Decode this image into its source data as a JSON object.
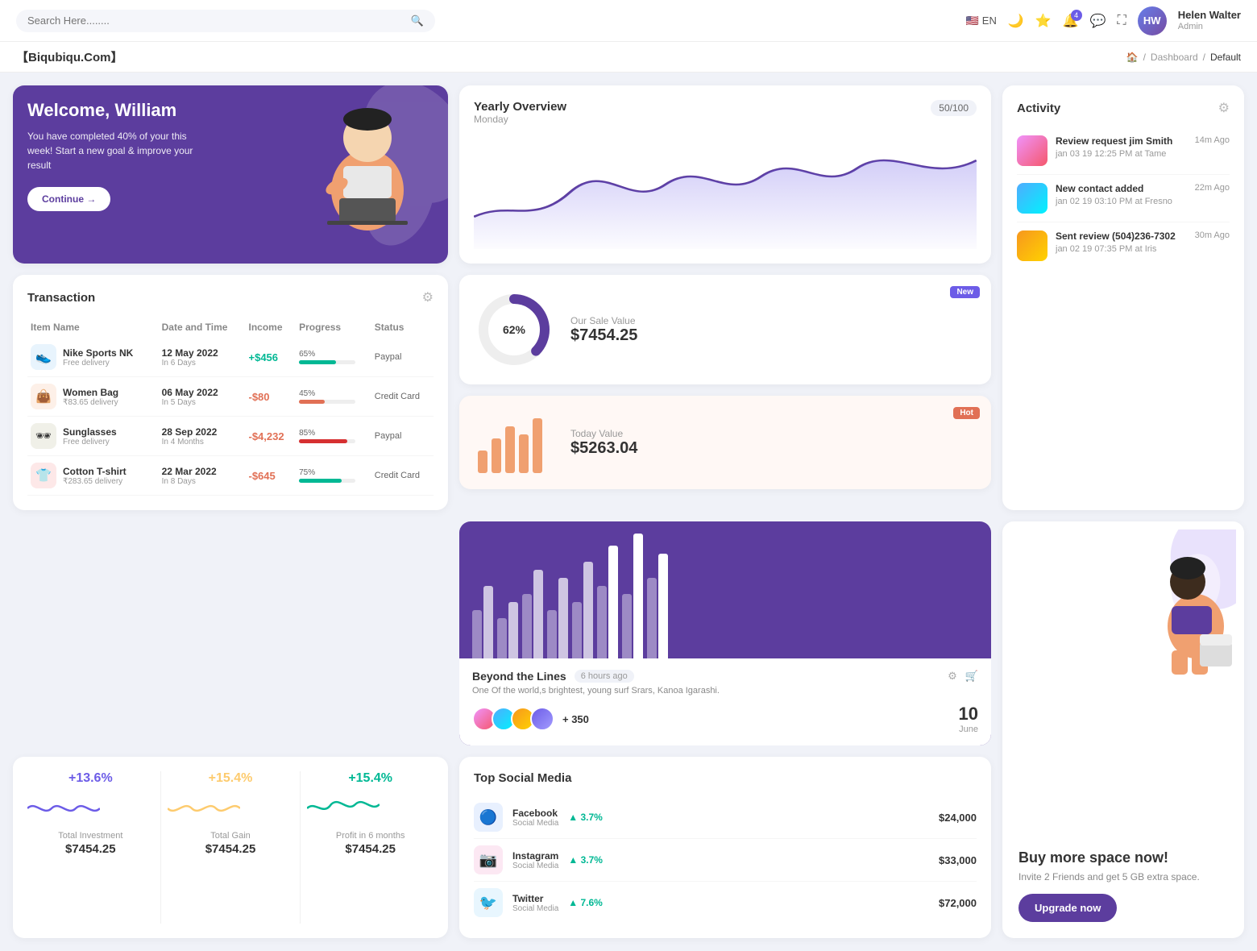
{
  "topbar": {
    "search_placeholder": "Search Here........",
    "lang": "EN",
    "notification_count": "4",
    "user_name": "Helen Walter",
    "user_role": "Admin"
  },
  "breadcrumb": {
    "brand": "【Biqubiqu.Com】",
    "home": "🏠",
    "dashboard": "Dashboard",
    "current": "Default"
  },
  "welcome": {
    "title": "Welcome, William",
    "subtitle": "You have completed 40% of your this week! Start a new goal & improve your result",
    "cta": "Continue →"
  },
  "yearly": {
    "title": "Yearly Overview",
    "subtitle": "Monday",
    "badge": "50/100"
  },
  "activity": {
    "title": "Activity",
    "items": [
      {
        "title": "Review request jim Smith",
        "subtitle": "jan 03 19 12:25 PM at Tame",
        "time": "14m Ago"
      },
      {
        "title": "New contact added",
        "subtitle": "jan 02 19 03:10 PM at Fresno",
        "time": "22m Ago"
      },
      {
        "title": "Sent review (504)236-7302",
        "subtitle": "jan 02 19 07:35 PM at Iris",
        "time": "30m Ago"
      }
    ]
  },
  "transaction": {
    "title": "Transaction",
    "columns": [
      "Item Name",
      "Date and Time",
      "Income",
      "Progress",
      "Status"
    ],
    "rows": [
      {
        "icon": "👟",
        "icon_bg": "#e8f4fd",
        "name": "Nike Sports NK",
        "sub": "Free delivery",
        "date": "12 May 2022",
        "days": "In 6 Days",
        "income": "+$456",
        "income_type": "pos",
        "progress": 65,
        "progress_color": "#00b894",
        "status": "Paypal"
      },
      {
        "icon": "👜",
        "icon_bg": "#fdf0e8",
        "name": "Women Bag",
        "sub": "₹83.65 delivery",
        "date": "06 May 2022",
        "days": "In 5 Days",
        "income": "-$80",
        "income_type": "neg",
        "progress": 45,
        "progress_color": "#e17055",
        "status": "Credit Card"
      },
      {
        "icon": "🕶",
        "icon_bg": "#f0f0e8",
        "name": "Sunglasses",
        "sub": "Free delivery",
        "date": "28 Sep 2022",
        "days": "In 4 Months",
        "income": "-$4,232",
        "income_type": "neg",
        "progress": 85,
        "progress_color": "#d63031",
        "status": "Paypal"
      },
      {
        "icon": "👕",
        "icon_bg": "#fde8e8",
        "name": "Cotton T-shirt",
        "sub": "₹283.65 delivery",
        "date": "22 Mar 2022",
        "days": "In 8 Days",
        "income": "-$645",
        "income_type": "neg",
        "progress": 75,
        "progress_color": "#00b894",
        "status": "Credit Card"
      }
    ]
  },
  "sale_value": {
    "badge": "New",
    "donut_pct": "62%",
    "label": "Our Sale Value",
    "value": "$7454.25"
  },
  "today_value": {
    "badge": "Hot",
    "label": "Today Value",
    "value": "$5263.04"
  },
  "beyond": {
    "title": "Beyond the Lines",
    "time_ago": "6 hours ago",
    "desc": "One Of the world,s brightest, young surf Srars, Kanoa Igarashi.",
    "extra_count": "+ 350",
    "date_day": "10",
    "date_month": "June"
  },
  "stats": [
    {
      "pct": "+13.6%",
      "label": "Total Investment",
      "value": "$7454.25",
      "color": "#6c5ce7"
    },
    {
      "pct": "+15.4%",
      "label": "Total Gain",
      "value": "$7454.25",
      "color": "#fdcb6e"
    },
    {
      "pct": "+15.4%",
      "label": "Profit in 6 months",
      "value": "$7454.25",
      "color": "#00b894"
    }
  ],
  "social": {
    "title": "Top Social Media",
    "items": [
      {
        "icon": "f",
        "icon_bg": "#e8f0fe",
        "icon_color": "#1877f2",
        "name": "Facebook",
        "type": "Social Media",
        "pct": "3.7%",
        "value": "$24,000"
      },
      {
        "icon": "📷",
        "icon_bg": "#fce8f3",
        "icon_color": "#e1306c",
        "name": "Instagram",
        "type": "Social Media",
        "pct": "3.7%",
        "value": "$33,000"
      },
      {
        "icon": "t",
        "icon_bg": "#e8f6fe",
        "icon_color": "#1da1f2",
        "name": "Twitter",
        "type": "Social Media",
        "pct": "7.6%",
        "value": "$72,000"
      }
    ]
  },
  "upgrade": {
    "title": "Buy more space now!",
    "desc": "Invite 2 Friends and get 5 GB extra space.",
    "cta": "Upgrade now"
  }
}
